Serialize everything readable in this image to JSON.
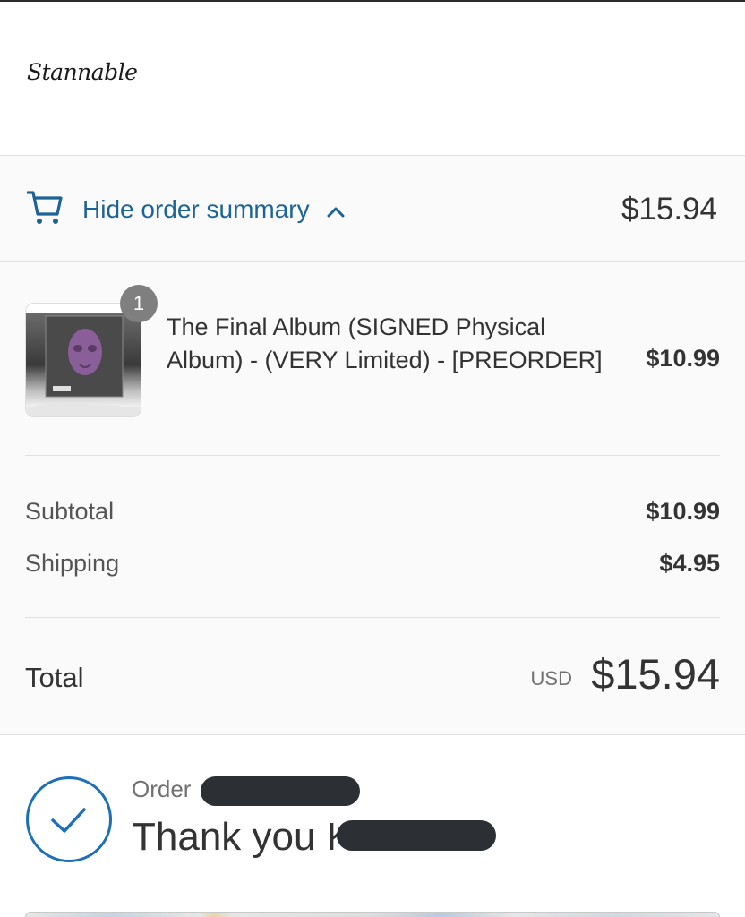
{
  "store": {
    "logo_text": "Stannable"
  },
  "summary_toggle": {
    "label": "Hide order summary",
    "total": "$15.94",
    "cart_icon": "cart-icon",
    "chevron_icon": "chevron-up-icon",
    "link_color": "#1c6497"
  },
  "items": [
    {
      "quantity": "1",
      "name": "The Final Album (SIGNED Physical Album) - (VERY Limited) - [PREORDER]",
      "price": "$10.99"
    }
  ],
  "costs": {
    "subtotal_label": "Subtotal",
    "subtotal_value": "$10.99",
    "shipping_label": "Shipping",
    "shipping_value": "$4.95"
  },
  "total": {
    "label": "Total",
    "currency": "USD",
    "value": "$15.94"
  },
  "confirmation": {
    "check_icon": "check-circle-icon",
    "order_label": "Order",
    "thanks_prefix": "Thank you K",
    "accent_color": "#1c6fb8"
  }
}
